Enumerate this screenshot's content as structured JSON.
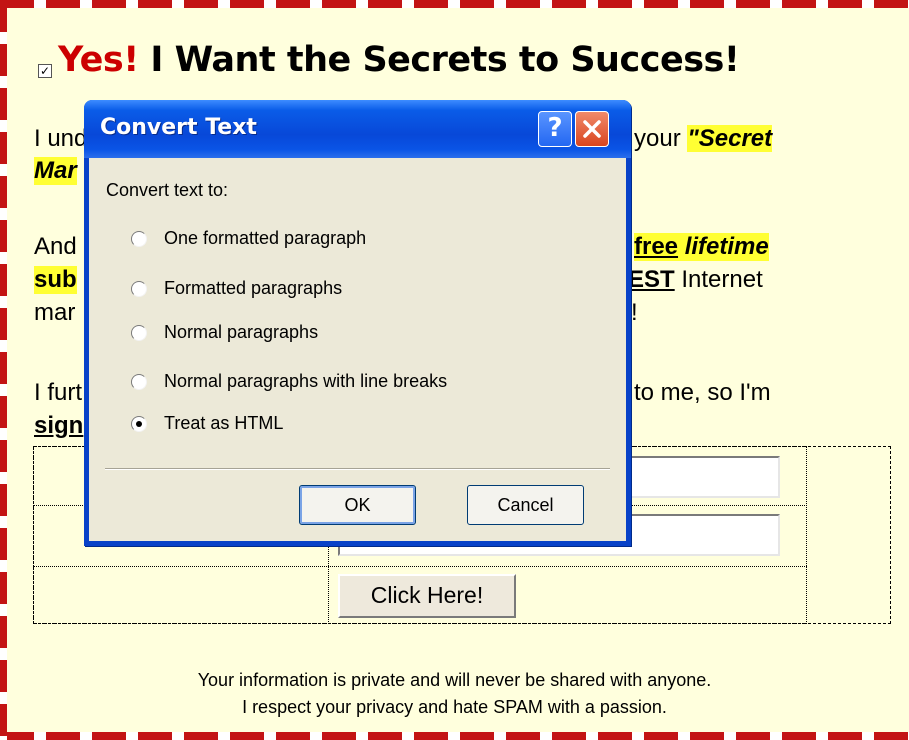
{
  "page": {
    "headline_yes": "Yes!",
    "headline_rest": " I Want the Secrets to Success!",
    "checkbox_checked": true,
    "para1": {
      "line1_start": "I und",
      "line1_end": "your ",
      "line1_highlight": "\"Secret",
      "line2_start": "Mar"
    },
    "para2": {
      "line1_start": "And",
      "line1_free": "free",
      "line1_lifetime": "lifetime",
      "line2_start": "sub",
      "line2_best": "EST",
      "line2_end": " Internet",
      "line3_start": "mar",
      "line3_end": "!"
    },
    "para3": {
      "line1_start": "I furt",
      "line1_end": "to me, so I'm",
      "line2_start": "sign"
    },
    "submit_label": "Click Here!",
    "footer_line1": "Your information is private and will never be shared with anyone.",
    "footer_line2": "I respect your privacy and hate SPAM with a passion.",
    "colors": {
      "background": "#ffffdd",
      "border_red": "#c31414",
      "headline_red": "#cc0000",
      "highlight": "#ffff33"
    }
  },
  "dialog": {
    "title": "Convert Text",
    "help_label": "?",
    "close_icon": "close-icon",
    "prompt": "Convert text to:",
    "options": [
      {
        "label": "One formatted paragraph",
        "selected": false
      },
      {
        "label": "Formatted paragraphs",
        "selected": false
      },
      {
        "label": "Normal paragraphs",
        "selected": false
      },
      {
        "label": "Normal paragraphs with line breaks",
        "selected": false
      },
      {
        "label": "Treat as HTML",
        "selected": true
      }
    ],
    "ok_label": "OK",
    "cancel_label": "Cancel",
    "colors": {
      "titlebar": "#0a54e6",
      "client": "#ece9d8"
    }
  }
}
